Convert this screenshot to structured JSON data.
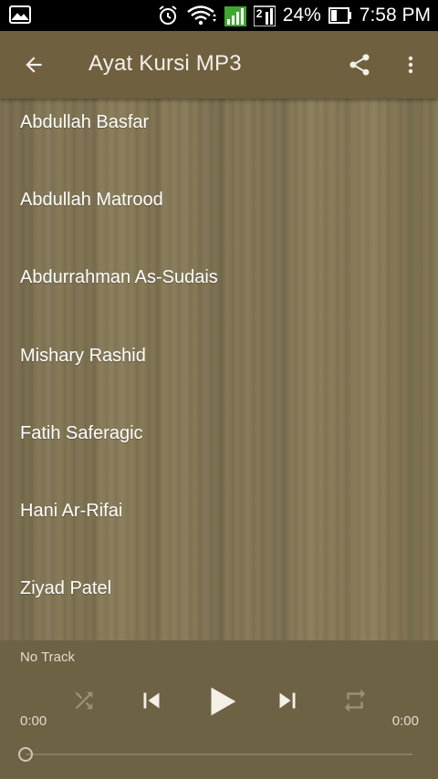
{
  "status_bar": {
    "battery": "24%",
    "time": "7:58 PM",
    "sim_slot_2": "2",
    "icons": [
      "photo-notification-icon",
      "alarm-icon",
      "wifi-icon",
      "signal-icon",
      "signal-2-icon",
      "battery-icon"
    ]
  },
  "app_bar": {
    "title": "Ayat Kursi MP3",
    "icons": [
      "back-arrow-icon",
      "share-icon",
      "more-vert-icon"
    ]
  },
  "reciters": [
    {
      "label": "Abdullah Basfar"
    },
    {
      "label": "Abdullah Matrood"
    },
    {
      "label": "Abdurrahman As-Sudais"
    },
    {
      "label": "Mishary Rashid"
    },
    {
      "label": "Fatih Saferagic"
    },
    {
      "label": "Hani Ar-Rifai"
    },
    {
      "label": "Ziyad Patel"
    }
  ],
  "player": {
    "track": "No Track",
    "elapsed": "0:00",
    "duration": "0:00",
    "progress": 0,
    "icons": [
      "shuffle-icon",
      "skip-previous-icon",
      "play-icon",
      "skip-next-icon",
      "repeat-icon"
    ]
  },
  "colors": {
    "app_bar": "#6f6040",
    "panel": "#6e6245",
    "text": "#ffffff"
  }
}
